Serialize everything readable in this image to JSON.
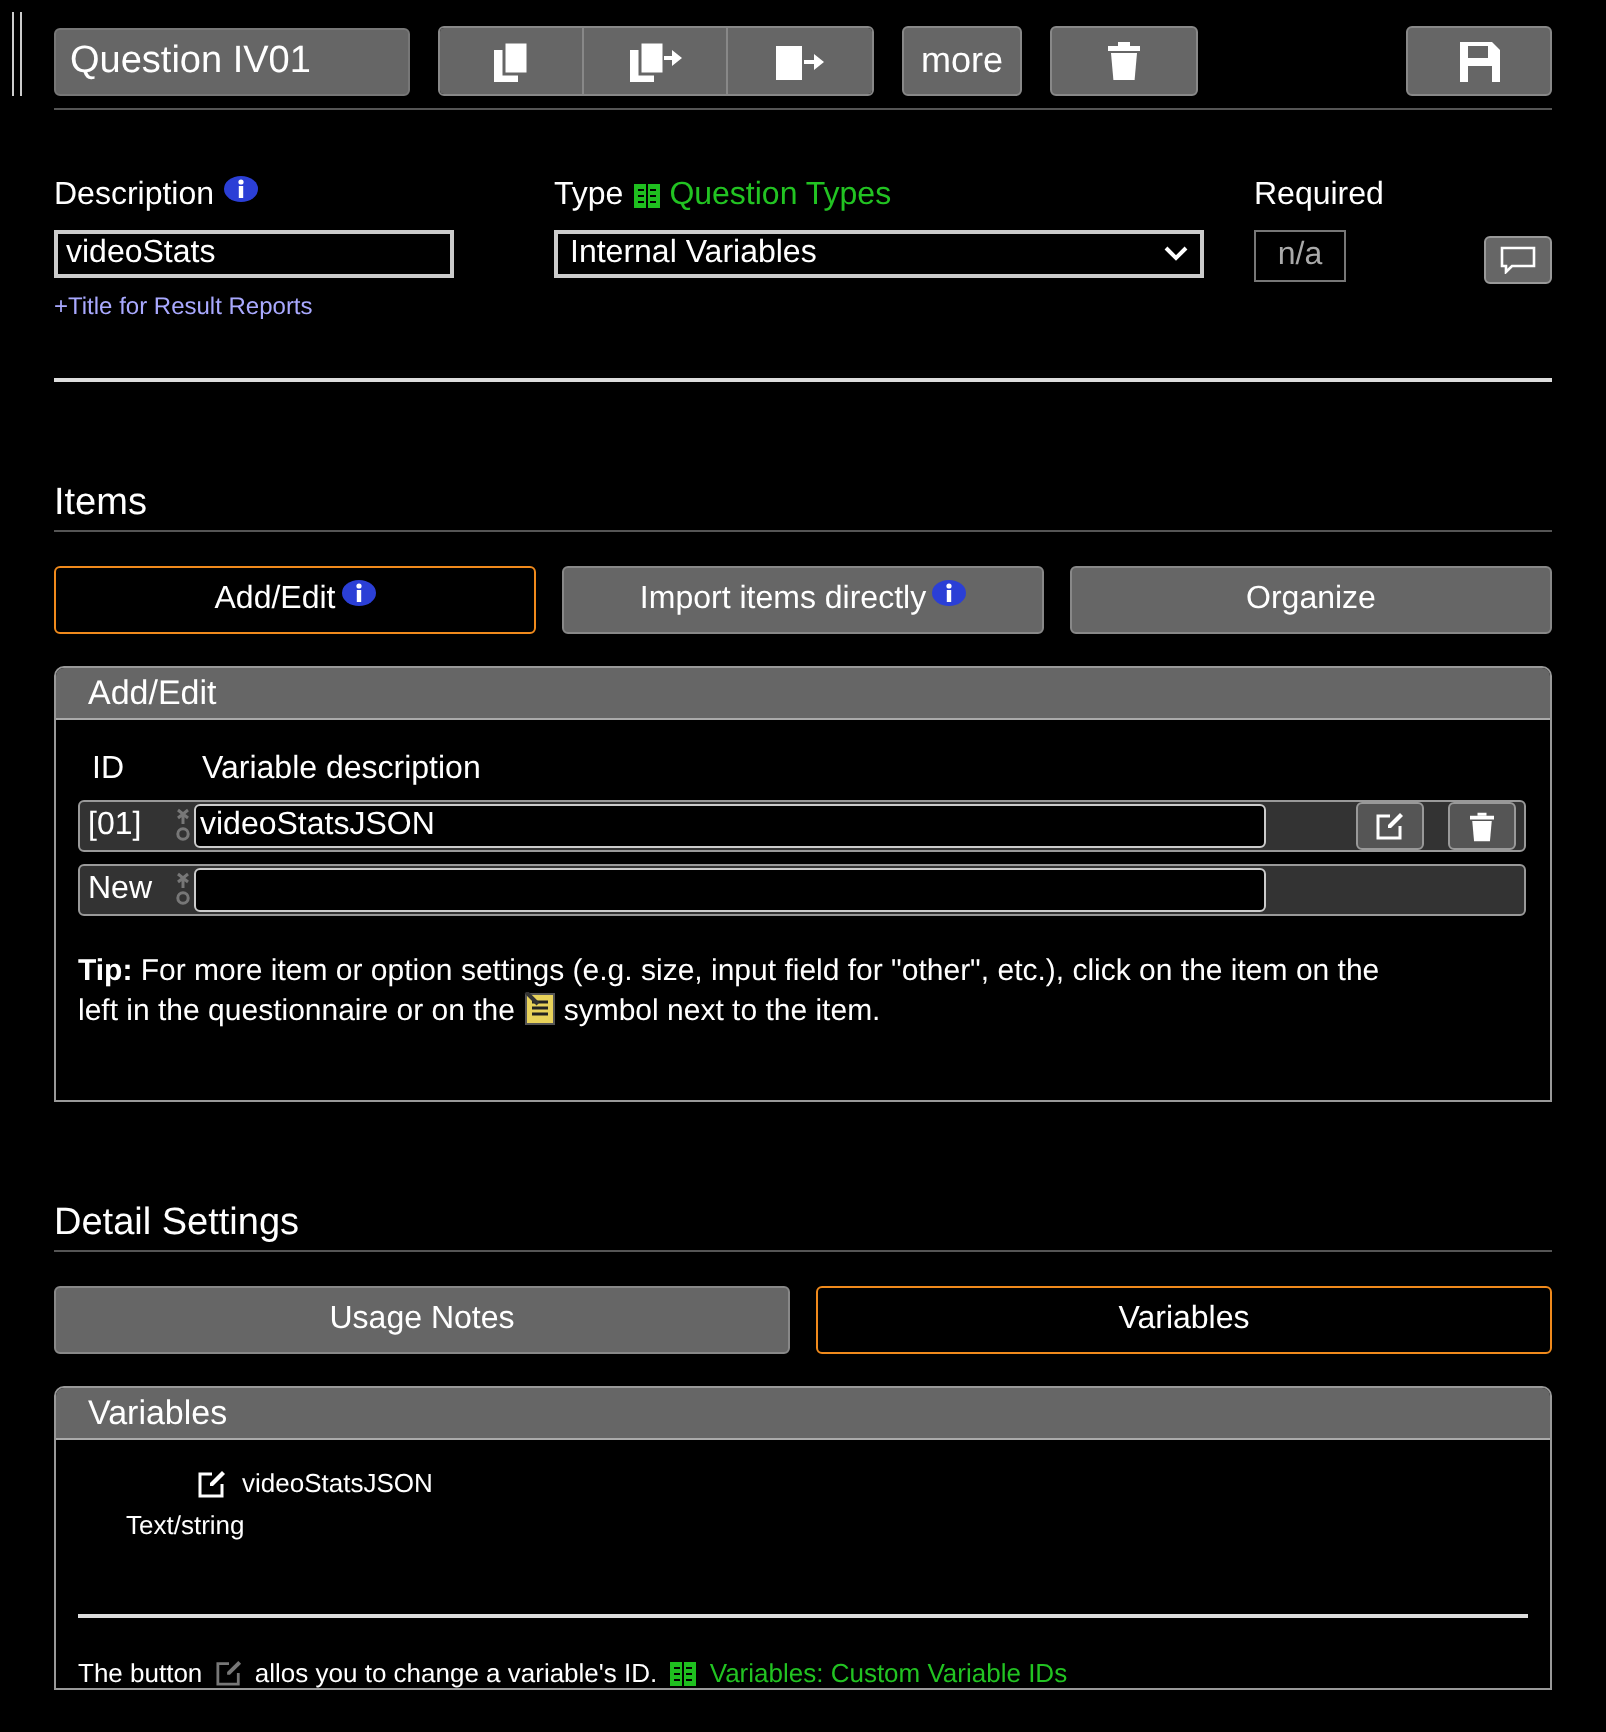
{
  "header": {
    "title": "Question IV01",
    "more_label": "more"
  },
  "fields": {
    "description_label": "Description",
    "description_value": "videoStats",
    "title_link": "+Title for Result Reports",
    "type_label": "Type",
    "type_link": "Question Types",
    "type_value": "Internal Variables",
    "required_label": "Required",
    "required_value": "n/a"
  },
  "items_section": {
    "heading": "Items",
    "tabs": [
      {
        "label": "Add/Edit",
        "info": true,
        "selected": true
      },
      {
        "label": "Import items directly",
        "info": true,
        "selected": false
      },
      {
        "label": "Organize",
        "info": false,
        "selected": false
      }
    ]
  },
  "add_edit_panel": {
    "title": "Add/Edit",
    "col_id": "ID",
    "col_description": "Variable description",
    "rows": [
      {
        "kind": "item",
        "id": "[01]",
        "value": "videoStatsJSON"
      },
      {
        "kind": "new",
        "id": "New",
        "value": ""
      }
    ],
    "tip_line": "**Tip:** For more item or option settings (e.g. size, input field for \"other\", etc.), click on the item on the",
    "tip_before": "left in the questionnaire or on the",
    "tip_after": "symbol next to the item."
  },
  "detail_section": {
    "heading": "Detail Settings",
    "tabs": [
      {
        "label": "Usage Notes",
        "selected": false
      },
      {
        "label": "Variables",
        "selected": true
      }
    ]
  },
  "variables_panel": {
    "title": "Variables",
    "variable": "videoStatsJSON",
    "variable_type": "Text/string",
    "note_before": "The button",
    "note_after": "allos you to change a variable's ID.",
    "note_link": "Variables: Custom Variable IDs"
  }
}
